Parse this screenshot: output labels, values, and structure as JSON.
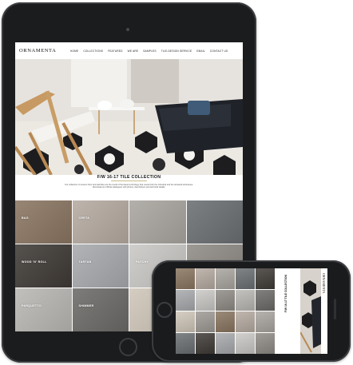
{
  "site": {
    "logo": "ORNAMENTA",
    "nav": [
      "HOME",
      "COLLECTIONS",
      "FEATURED",
      "WE ARE",
      "SAMPLES",
      "TILE-DESIGN SERVICE",
      "EMAIL",
      "CONTACT US"
    ]
  },
  "collection": {
    "title": "F/W 16-17 TILE COLLECTION",
    "description": "Our collection of ceramic floor and wall tiles are the result of the latest technology that meets both the industrial and the artisanal techniques. Download our official catalogues with photos, descriptions and technical details."
  },
  "tiles": [
    {
      "label": "BAG",
      "bg": "#8a7561"
    },
    {
      "label": "CRETA",
      "bg": "#b5aaa1"
    },
    {
      "label": "",
      "bg": "#a9a59f"
    },
    {
      "label": "",
      "bg": "#6b6f72"
    },
    {
      "label": "WOOD 'N' ROLL",
      "bg": "#3f3a36"
    },
    {
      "label": "TARTAN",
      "bg": "#a7a9ac"
    },
    {
      "label": "PATCHY",
      "bg": "#c9c8c5"
    },
    {
      "label": "",
      "bg": "#8f8b85"
    },
    {
      "label": "PARQUETTO",
      "bg": "#b9b7b3"
    },
    {
      "label": "SHIMMER",
      "bg": "#6c6a67"
    },
    {
      "label": "",
      "bg": "#cfc6b9"
    },
    {
      "label": "",
      "bg": "#9e9994"
    }
  ],
  "phone": {
    "logo": "ORNAMENTA",
    "title": "F/W 16-17 TILE COLLECTION"
  },
  "colors": {
    "device": "#1b1c1e",
    "accent": "#c8b98a"
  }
}
